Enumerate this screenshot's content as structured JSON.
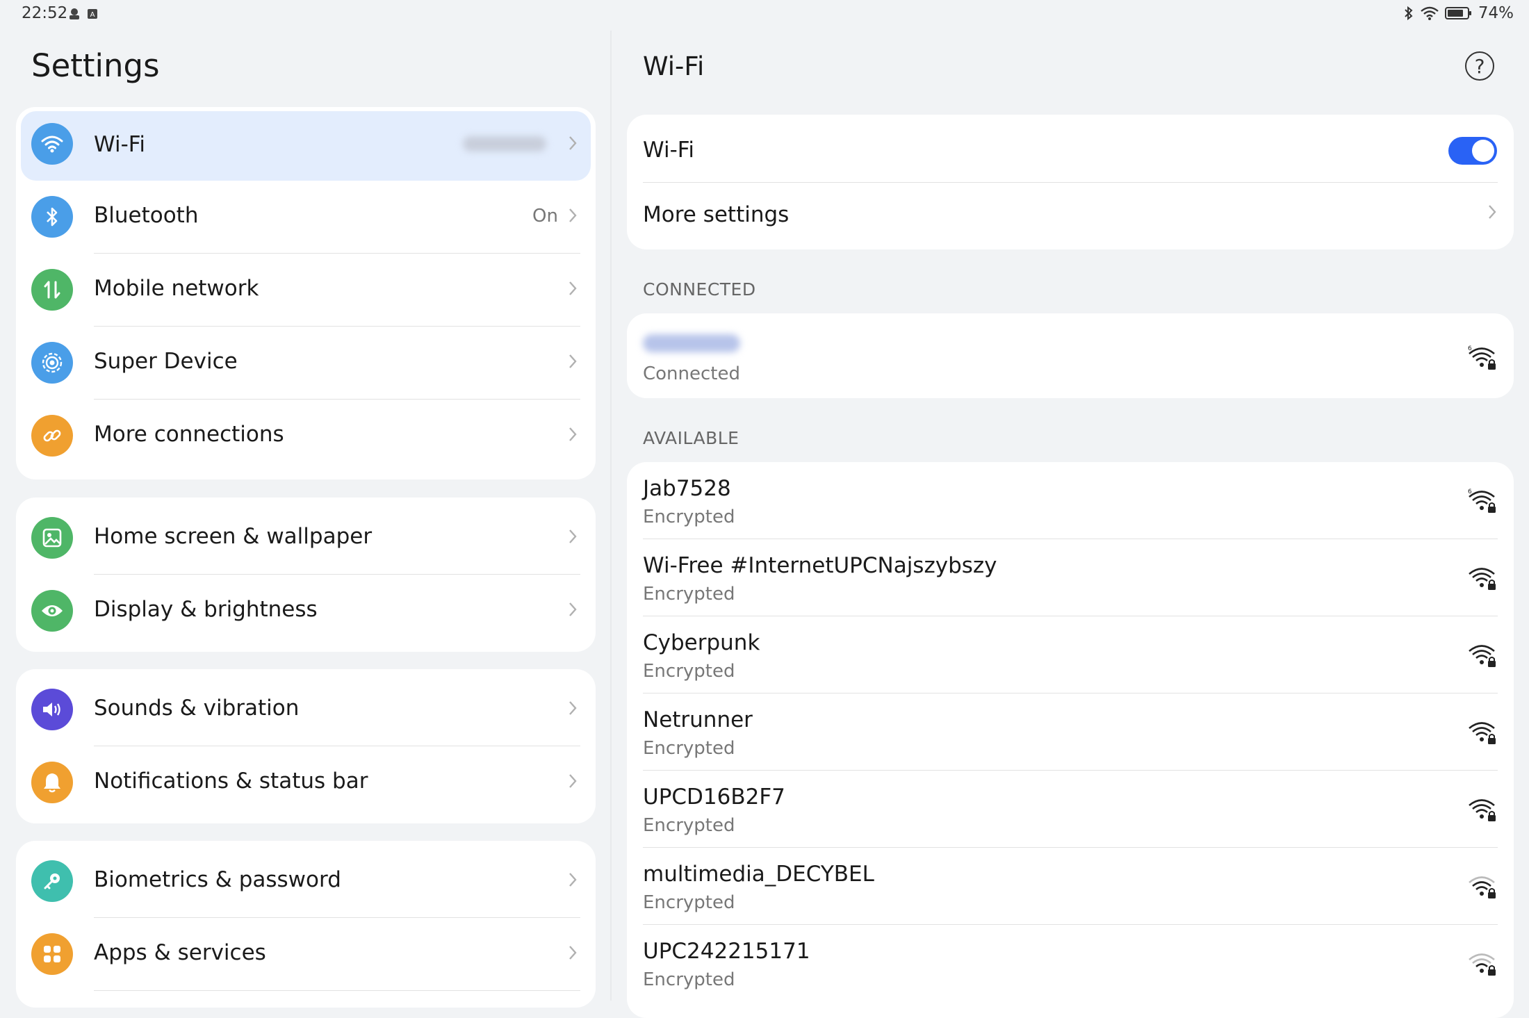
{
  "status_bar": {
    "time": "22:52",
    "battery": "74%"
  },
  "left": {
    "title": "Settings",
    "groups": [
      {
        "items": [
          {
            "label": "Wi-Fi",
            "icon": "wifi-icon",
            "color": "#4a9ee8",
            "value": "",
            "selected": true
          },
          {
            "label": "Bluetooth",
            "icon": "bluetooth-icon",
            "color": "#4a9ee8",
            "value": "On"
          },
          {
            "label": "Mobile network",
            "icon": "mobile-data-icon",
            "color": "#4fb667",
            "value": ""
          },
          {
            "label": "Super Device",
            "icon": "super-device-icon",
            "color": "#4a9ee8",
            "value": ""
          },
          {
            "label": "More connections",
            "icon": "link-icon",
            "color": "#f0a030",
            "value": ""
          }
        ]
      },
      {
        "items": [
          {
            "label": "Home screen & wallpaper",
            "icon": "image-icon",
            "color": "#4fb667",
            "value": ""
          },
          {
            "label": "Display & brightness",
            "icon": "eye-icon",
            "color": "#4fb667",
            "value": ""
          }
        ]
      },
      {
        "items": [
          {
            "label": "Sounds & vibration",
            "icon": "speaker-icon",
            "color": "#5b4bd8",
            "value": ""
          },
          {
            "label": "Notifications & status bar",
            "icon": "bell-icon",
            "color": "#f0a030",
            "value": ""
          }
        ]
      },
      {
        "items": [
          {
            "label": "Biometrics & password",
            "icon": "key-icon",
            "color": "#3fbfae",
            "value": ""
          },
          {
            "label": "Apps & services",
            "icon": "apps-grid-icon",
            "color": "#f0a030",
            "value": ""
          }
        ]
      }
    ]
  },
  "right": {
    "title": "Wi-Fi",
    "wifi_toggle_label": "Wi-Fi",
    "wifi_enabled": true,
    "more_settings_label": "More settings",
    "connected_header": "CONNECTED",
    "connected_status": "Connected",
    "available_header": "AVAILABLE",
    "networks": [
      {
        "name": "Jab7528",
        "status": "Encrypted",
        "wifi6": true
      },
      {
        "name": "Wi-Free #InternetUPCNajszybszy",
        "status": "Encrypted",
        "wifi6": false
      },
      {
        "name": "Cyberpunk",
        "status": "Encrypted",
        "wifi6": false
      },
      {
        "name": "Netrunner",
        "status": "Encrypted",
        "wifi6": false
      },
      {
        "name": "UPCD16B2F7",
        "status": "Encrypted",
        "wifi6": false
      },
      {
        "name": "multimedia_DECYBEL",
        "status": "Encrypted",
        "wifi6": false
      },
      {
        "name": "UPC242215171",
        "status": "Encrypted",
        "wifi6": false
      }
    ]
  },
  "colors": {
    "accent": "#2962f5",
    "selected_bg": "#e3edfd"
  }
}
